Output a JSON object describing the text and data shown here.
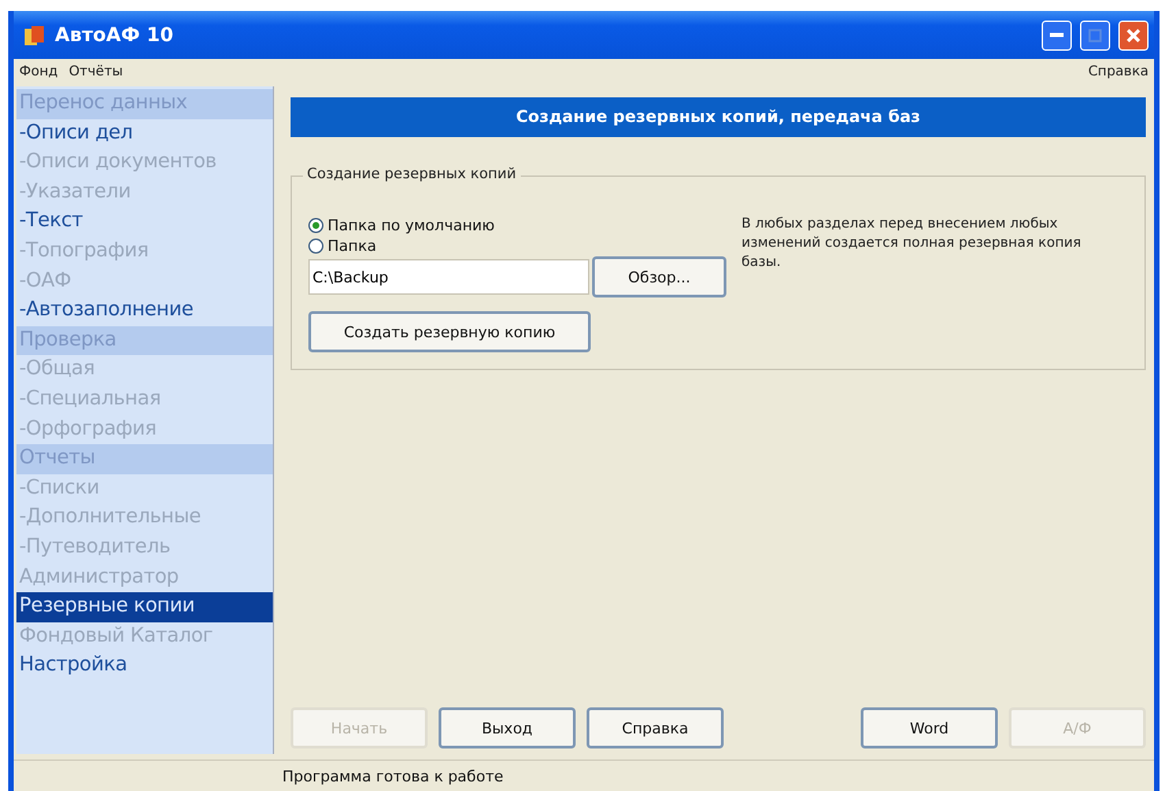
{
  "window": {
    "title": "АвтоАФ 10"
  },
  "menu": {
    "left": [
      "Фонд",
      "Отчёты"
    ],
    "right": "Справка"
  },
  "sidebar": {
    "items": [
      {
        "label": "Перенос данных",
        "kind": "section",
        "selected": false
      },
      {
        "label": "-Описи дел",
        "kind": "item",
        "disabled": false,
        "selected": false
      },
      {
        "label": "-Описи документов",
        "kind": "item",
        "disabled": true,
        "selected": false
      },
      {
        "label": "-Указатели",
        "kind": "item",
        "disabled": true,
        "selected": false
      },
      {
        "label": "-Текст",
        "kind": "item",
        "disabled": false,
        "selected": false
      },
      {
        "label": "-Топография",
        "kind": "item",
        "disabled": true,
        "selected": false
      },
      {
        "label": "-ОАФ",
        "kind": "item",
        "disabled": true,
        "selected": false
      },
      {
        "label": "-Автозаполнение",
        "kind": "item",
        "disabled": false,
        "selected": false
      },
      {
        "label": "Проверка",
        "kind": "section",
        "selected": false
      },
      {
        "label": "-Общая",
        "kind": "item",
        "disabled": true,
        "selected": false
      },
      {
        "label": "-Специальная",
        "kind": "item",
        "disabled": true,
        "selected": false
      },
      {
        "label": "-Орфография",
        "kind": "item",
        "disabled": true,
        "selected": false
      },
      {
        "label": "Отчеты",
        "kind": "section",
        "selected": false
      },
      {
        "label": "-Списки",
        "kind": "item",
        "disabled": true,
        "selected": false
      },
      {
        "label": "-Дополнительные",
        "kind": "item",
        "disabled": true,
        "selected": false
      },
      {
        "label": "-Путеводитель",
        "kind": "item",
        "disabled": true,
        "selected": false
      },
      {
        "label": "Администратор",
        "kind": "item",
        "disabled": true,
        "selected": false
      },
      {
        "label": "Резервные копии",
        "kind": "item",
        "disabled": false,
        "selected": true
      },
      {
        "label": "Фондовый Каталог",
        "kind": "item",
        "disabled": true,
        "selected": false
      },
      {
        "label": "Настройка",
        "kind": "item",
        "disabled": false,
        "selected": false
      }
    ]
  },
  "panel": {
    "title": "Создание резервных копий, передача баз",
    "group": {
      "title": "Создание резервных копий",
      "radios": [
        {
          "label": "Папка по умолчанию",
          "selected": true
        },
        {
          "label": "Папка",
          "selected": false
        }
      ],
      "path": "C:\\Backup",
      "browse": "Обзор...",
      "create": "Создать резервную копию",
      "note": "В любых разделах перед внесением любых изменений создается полная резервная копия базы."
    },
    "buttons": [
      {
        "label": "Начать",
        "disabled": true
      },
      {
        "label": "Выход",
        "disabled": false
      },
      {
        "label": "Справка",
        "disabled": false
      },
      {
        "label": "Word",
        "disabled": false
      },
      {
        "label": "А/Ф",
        "disabled": true
      }
    ]
  },
  "status_bar": "Программа готова к работе"
}
